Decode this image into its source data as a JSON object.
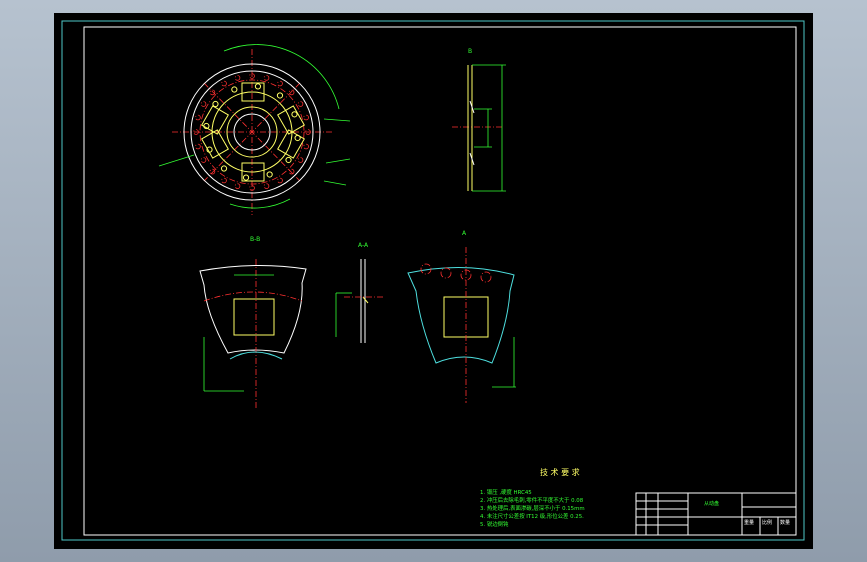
{
  "tech_requirements": {
    "title": "技 术 要 求",
    "items": [
      "1. 锻压 ,硬度 HRC45",
      "2. 冲压后去除毛刺,零件不平度不大于 0.08",
      "3. 热处理后,表面渗碳,层深不小于 0.15mm",
      "4. 未注尺寸公差按 IT12 级,形位公差 0.25.",
      "5. 锐边倒钝"
    ]
  },
  "section_labels": {
    "section_b": "B-B",
    "section_a": "A-A",
    "view_a": "A",
    "view_b": "B"
  },
  "title_block": {
    "part_name": "从动盘",
    "scale_label": "比例",
    "weight_label": "重量",
    "qty_label": "数量"
  },
  "colors": {
    "frame": "#4ec8c8",
    "outline_yellow": "#ffff66",
    "outline_white": "#ffffff",
    "outline_cyan": "#4ee0e0",
    "dimension_green": "#33ff33",
    "centerline_red": "#ff3030"
  }
}
